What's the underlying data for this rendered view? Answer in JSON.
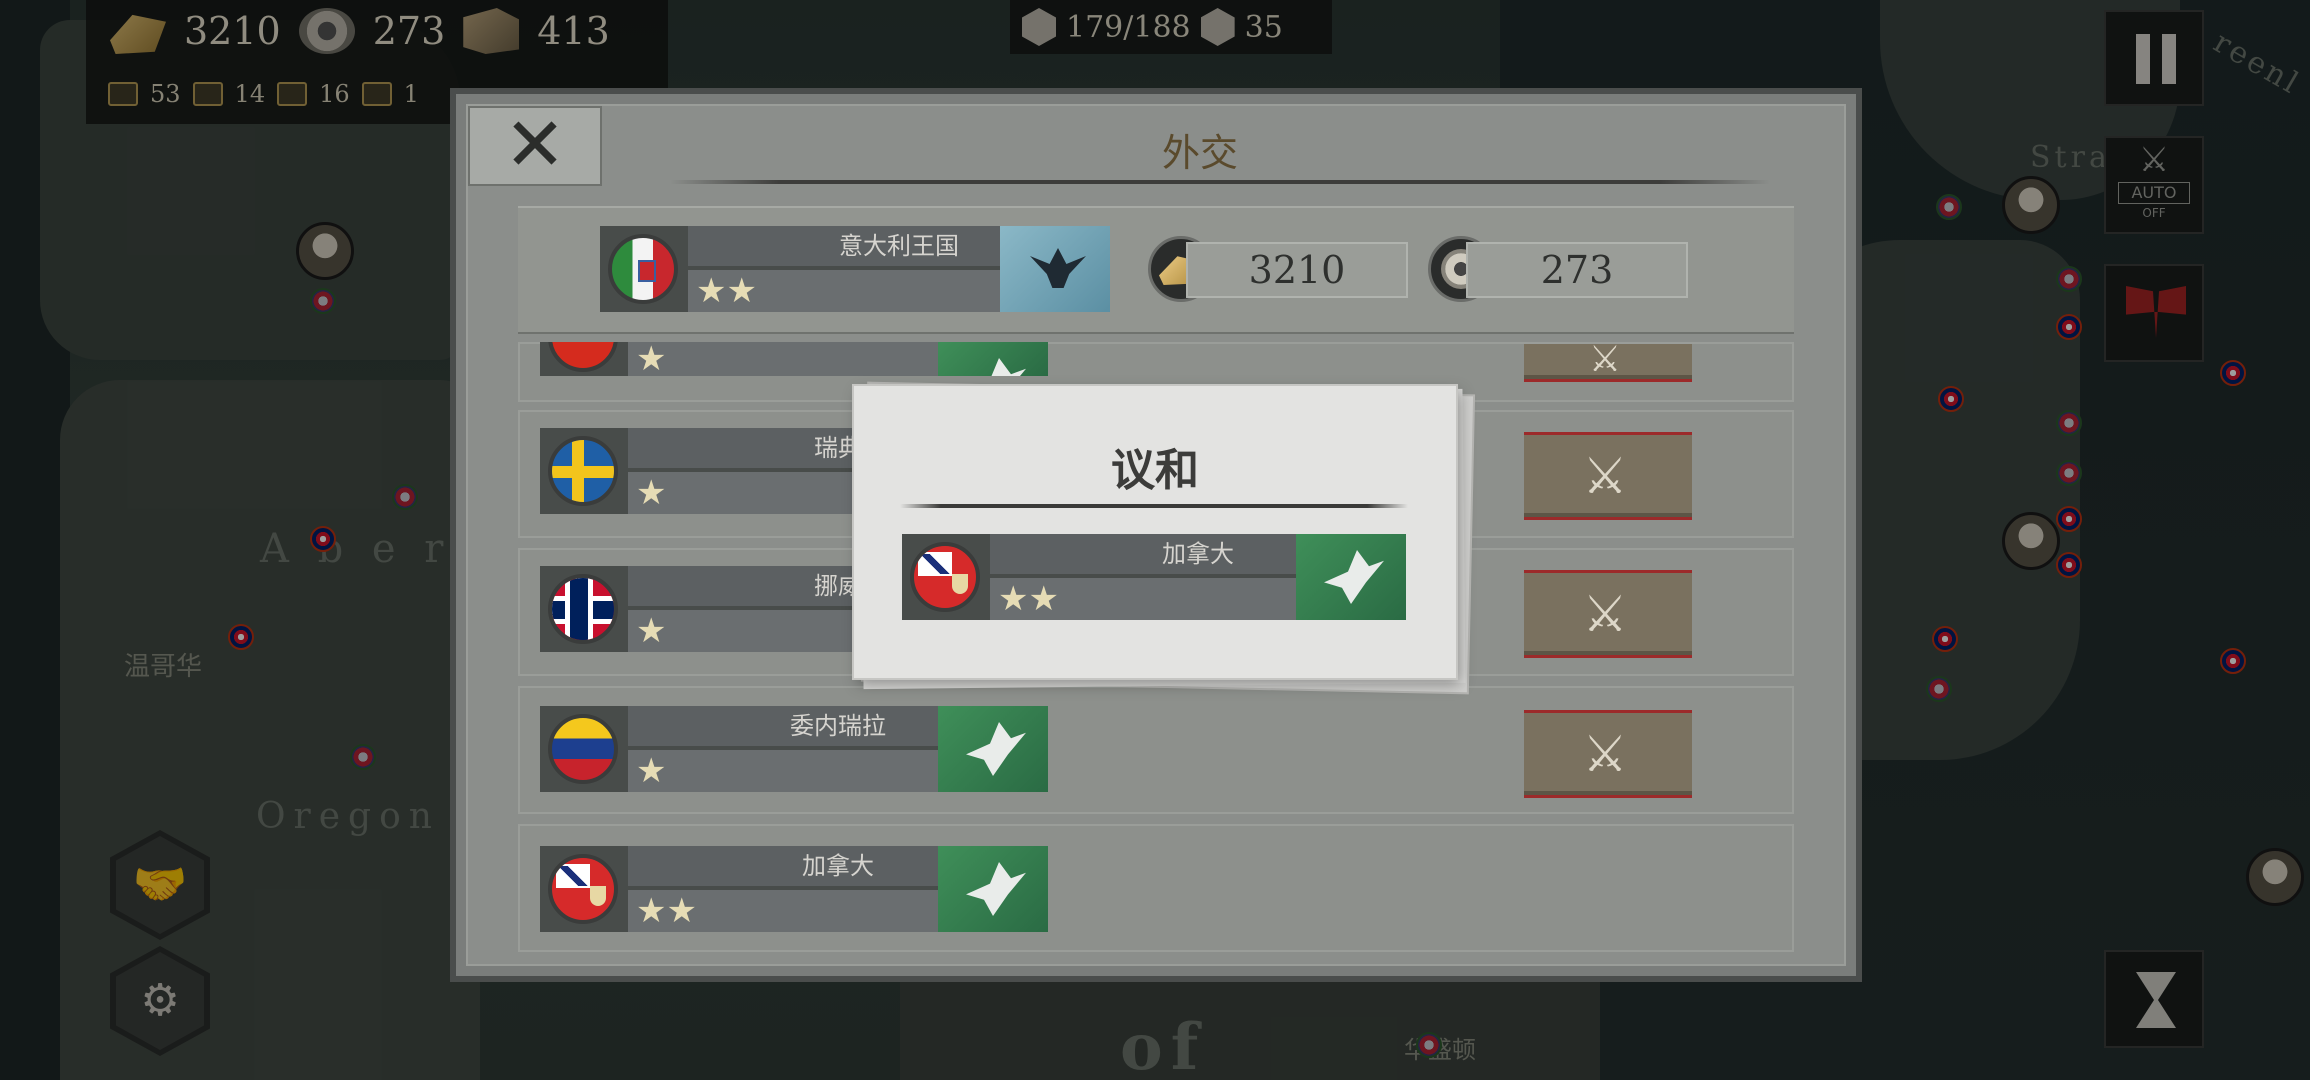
{
  "hud": {
    "gold": "3210",
    "manpower": "273",
    "industry": "413",
    "units": [
      "53",
      "14",
      "16",
      "1"
    ],
    "population": "179/188",
    "cards": "35"
  },
  "map": {
    "city_label": "温哥华",
    "region_oregon": "Oregon",
    "region_alberta": "A   b   e   r",
    "region_of": "of",
    "city_bottom": "华盛顿",
    "sea_label": "Strai",
    "corner_label": "reenl"
  },
  "side": {
    "auto_label": "AUTO",
    "auto_state": "OFF"
  },
  "diplomacy": {
    "title": "外交",
    "player": {
      "name": "意大利王国",
      "stars": "★★"
    },
    "gold": "3210",
    "manpower": "273",
    "nations": [
      {
        "name": "",
        "stars": "★",
        "war": true
      },
      {
        "name": "瑞典",
        "stars": "★",
        "war": true
      },
      {
        "name": "挪威",
        "stars": "★",
        "war": true
      },
      {
        "name": "委内瑞拉",
        "stars": "★",
        "war": true
      },
      {
        "name": "加拿大",
        "stars": "★★",
        "war": false
      }
    ]
  },
  "peace_popup": {
    "title": "议和",
    "nation": {
      "name": "加拿大",
      "stars": "★★"
    }
  },
  "colors": {
    "war_stripe": "#9c2a2a",
    "dove_green": "#3f8f59",
    "eagle_blue": "#6b9fb3"
  }
}
